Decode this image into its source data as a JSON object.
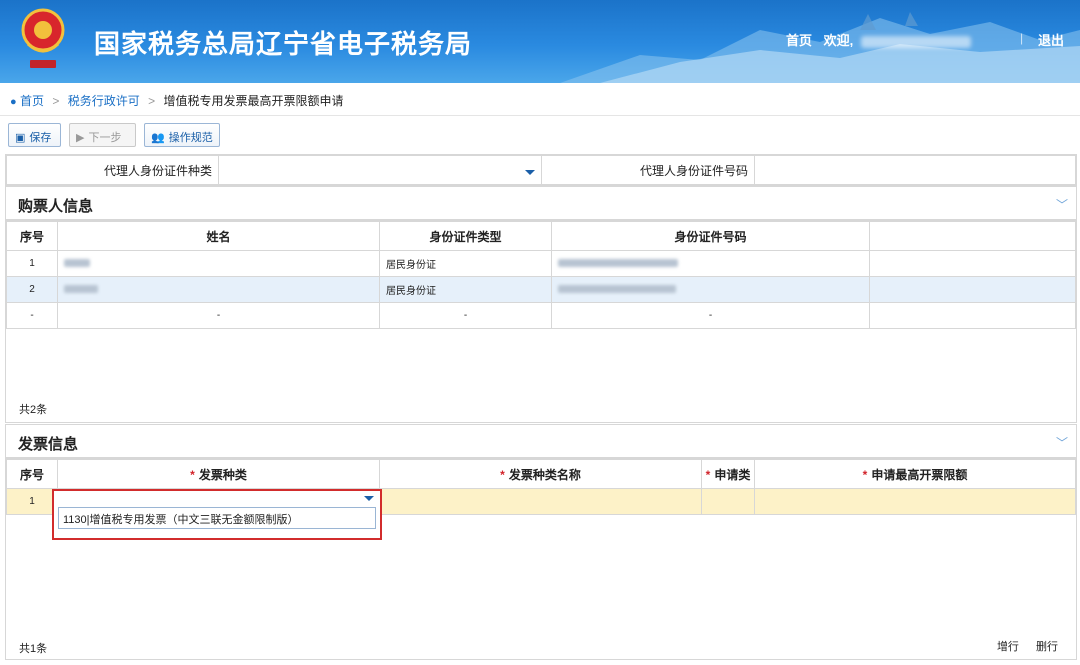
{
  "header": {
    "title": "国家税务总局辽宁省电子税务局",
    "home_link": "首页",
    "welcome": "欢迎,",
    "logout": "退出"
  },
  "breadcrumb": {
    "items": [
      "首页",
      "税务行政许可",
      "增值税专用发票最高开票限额申请"
    ]
  },
  "toolbar": {
    "save": "保存",
    "next": "下一步",
    "guide": "操作规范"
  },
  "agent": {
    "id_type_label": "代理人身份证件种类",
    "id_type_value": "",
    "id_number_label": "代理人身份证件号码",
    "id_number_value": ""
  },
  "buyers": {
    "title": "购票人信息",
    "columns": [
      "序号",
      "姓名",
      "身份证件类型",
      "身份证件号码"
    ],
    "rows": [
      {
        "no": "1",
        "id_type": "居民身份证"
      },
      {
        "no": "2",
        "id_type": "居民身份证"
      },
      {
        "no": "-",
        "name": "-",
        "id_type": "-",
        "id_number": "-"
      }
    ],
    "total": "共2条"
  },
  "invoices": {
    "title": "发票信息",
    "columns": [
      "序号",
      "发票种类",
      "发票种类名称",
      "申请类",
      "申请最高开票限额"
    ],
    "required_mark": "*",
    "rows": [
      {
        "no": "1"
      }
    ],
    "dropdown_option": "1130|增值税专用发票（中文三联无金额限制版）",
    "total": "共1条",
    "add_row": "增行",
    "delete_row": "删行"
  },
  "colors": {
    "header_blue": "#2a8ae0",
    "link_blue": "#1a6fc5",
    "required_red": "#d2232a",
    "highlight_yellow": "#fdf2c8",
    "row_alt": "#e6f0fa"
  }
}
